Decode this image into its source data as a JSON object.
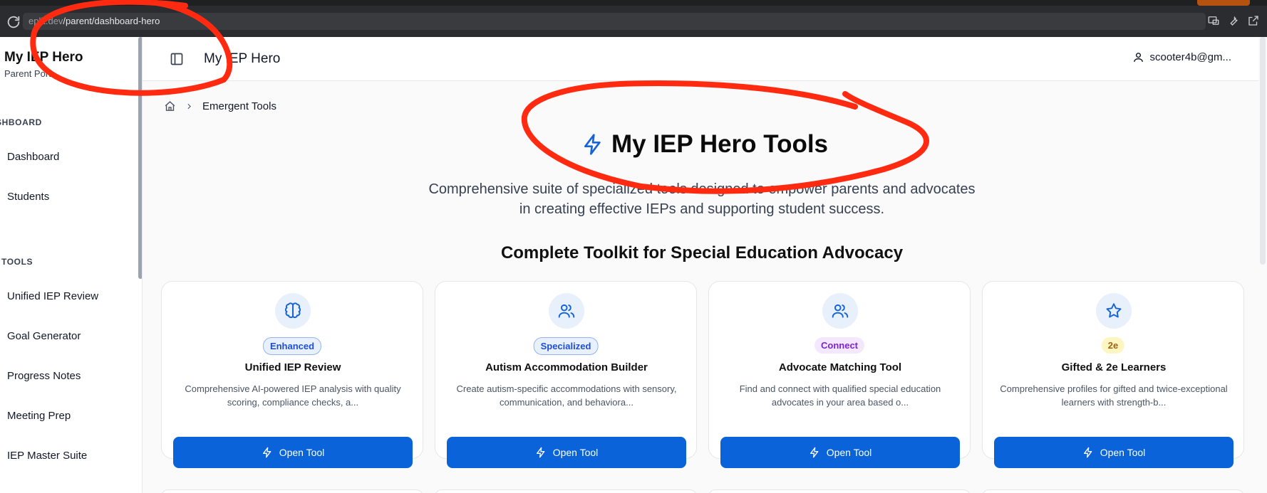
{
  "browser": {
    "url_prefix": "eplit.dev",
    "url_path": "/parent/dashboard-hero"
  },
  "sidebar": {
    "title": "My IEP Hero",
    "subtitle": "Parent Port",
    "dashboard_section": "SHBOARD",
    "dashboard_items": [
      {
        "label": "Dashboard"
      },
      {
        "label": "Students"
      }
    ],
    "tools_section": "TOOLS",
    "tool_items": [
      {
        "label": "Unified IEP Review"
      },
      {
        "label": "Goal Generator"
      },
      {
        "label": "Progress Notes"
      },
      {
        "label": "Meeting Prep"
      },
      {
        "label": "IEP Master Suite"
      }
    ]
  },
  "header": {
    "title": "My IEP Hero",
    "user": "scooter4b@gm..."
  },
  "breadcrumb": {
    "current": "Emergent Tools"
  },
  "main": {
    "heading": "My IEP Hero Tools",
    "intro": "Comprehensive suite of specialized tools designed to empower parents and advocates in creating effective IEPs and supporting student success.",
    "section_heading": "Complete Toolkit for Special Education Advocacy"
  },
  "cards": [
    {
      "icon": "brain-icon",
      "badge": "Enhanced",
      "title": "Unified IEP Review",
      "description": "Comprehensive AI-powered IEP analysis with quality scoring, compliance checks, a...",
      "button": "Open Tool"
    },
    {
      "icon": "users-icon",
      "badge": "Specialized",
      "title": "Autism Accommodation Builder",
      "description": "Create autism-specific accommodations with sensory, communication, and behaviora...",
      "button": "Open Tool"
    },
    {
      "icon": "users-icon",
      "badge": "Connect",
      "title": "Advocate Matching Tool",
      "description": "Find and connect with qualified special education advocates in your area based o...",
      "button": "Open Tool"
    },
    {
      "icon": "star-icon",
      "badge": "2e",
      "title": "Gifted & 2e Learners",
      "description": "Comprehensive profiles for gifted and twice-exceptional learners with strength-b...",
      "button": "Open Tool"
    }
  ],
  "colors": {
    "primary": "#0b63d9",
    "annotation": "#ff2a10"
  }
}
